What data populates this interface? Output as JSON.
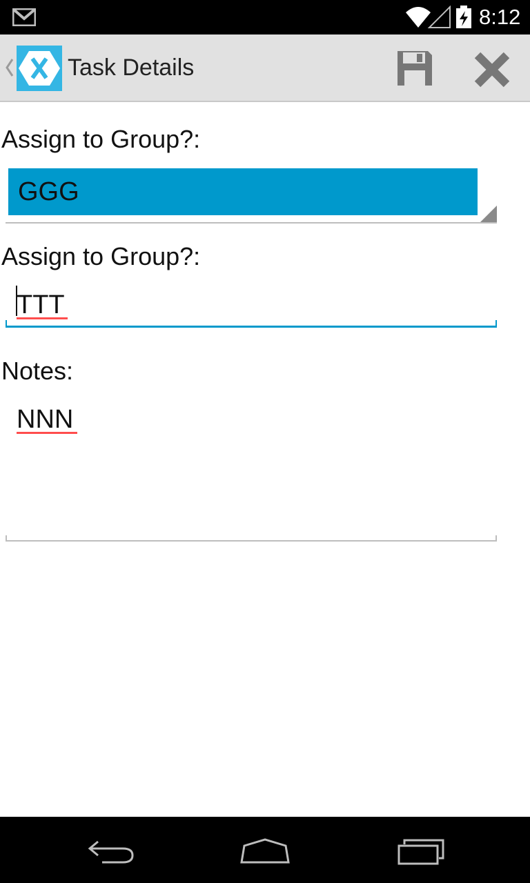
{
  "status_bar": {
    "time": "8:12",
    "icons": [
      "gmail-icon",
      "wifi-icon",
      "signal-icon",
      "battery-charging-icon"
    ]
  },
  "action_bar": {
    "title": "Task Details",
    "logo_color": "#34b6e4",
    "actions": [
      {
        "name": "save",
        "icon": "floppy-disk-icon"
      },
      {
        "name": "cancel",
        "icon": "close-icon"
      }
    ]
  },
  "form": {
    "group_label": "Assign to Group?:",
    "group_value": "GGG",
    "assignee_label": "Assign to Group?:",
    "assignee_value": "TTT",
    "notes_label": "Notes:",
    "notes_value": "NNN",
    "spinner_color": "#0099cc",
    "focus_color": "#0099cc"
  },
  "nav_bar": {
    "buttons": [
      "back-icon",
      "home-icon",
      "recents-icon"
    ]
  }
}
